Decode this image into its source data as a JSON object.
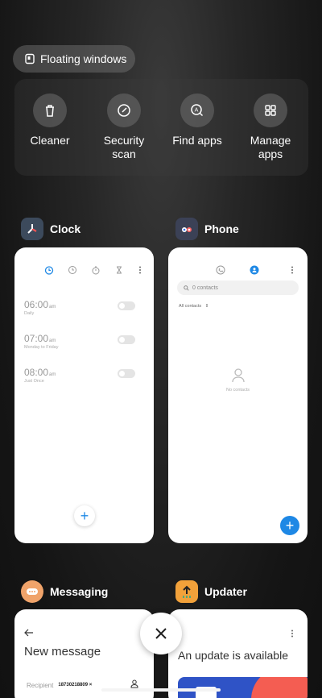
{
  "floating_windows": {
    "label": "Floating windows"
  },
  "quick_actions": [
    {
      "label": "Cleaner",
      "icon": "trash-icon"
    },
    {
      "label": "Security\nscan",
      "icon": "security-icon"
    },
    {
      "label": "Find apps",
      "icon": "find-apps-icon"
    },
    {
      "label": "Manage\napps",
      "icon": "grid-icon"
    }
  ],
  "cards": {
    "clock": {
      "title": "Clock",
      "alarms": [
        {
          "time": "06:00",
          "ampm": "am",
          "repeat": "Daily"
        },
        {
          "time": "07:00",
          "ampm": "am",
          "repeat": "Monday to Friday"
        },
        {
          "time": "08:00",
          "ampm": "am",
          "repeat": "Just Once"
        }
      ]
    },
    "phone": {
      "title": "Phone",
      "search_placeholder": "0 contacts",
      "filter": "All contacts",
      "empty_text": "No contacts"
    },
    "messaging": {
      "title": "Messaging",
      "heading": "New message",
      "recipient_label": "Recipient",
      "recipient_value": "18730218809"
    },
    "updater": {
      "title": "Updater",
      "heading": "An update is available"
    }
  },
  "colors": {
    "accent": "#1e88e5",
    "clock_blue": "#1e88e5",
    "msg_orange": "#f0a36a",
    "upd_orange": "#f2a13a"
  }
}
